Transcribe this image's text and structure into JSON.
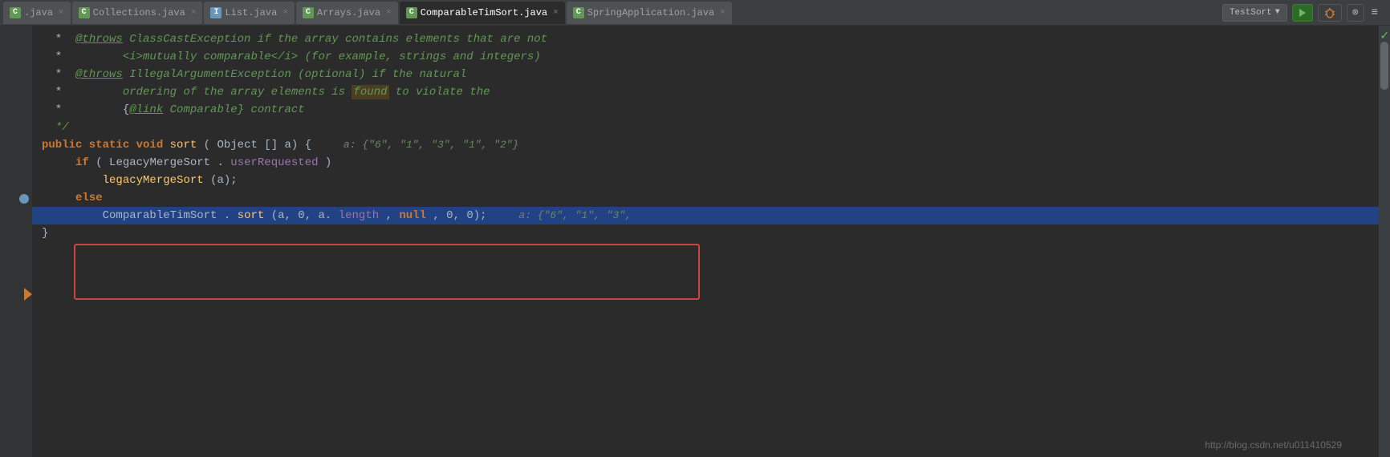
{
  "tabs": [
    {
      "id": "java1",
      "label": ".java",
      "icon": "C",
      "iconColor": "green",
      "active": false,
      "closable": true
    },
    {
      "id": "collections",
      "label": "Collections.java",
      "icon": "C",
      "iconColor": "green",
      "active": false,
      "closable": true
    },
    {
      "id": "list",
      "label": "List.java",
      "icon": "I",
      "iconColor": "blue-i",
      "active": false,
      "closable": true
    },
    {
      "id": "arrays",
      "label": "Arrays.java",
      "icon": "C",
      "iconColor": "green",
      "active": false,
      "closable": true
    },
    {
      "id": "comparabletimsort",
      "label": "ComparableTimSort.java",
      "icon": "C",
      "iconColor": "green",
      "active": true,
      "closable": true
    },
    {
      "id": "springapplication",
      "label": "SpringApplication.java",
      "icon": "C",
      "iconColor": "green",
      "active": false,
      "closable": true
    }
  ],
  "toolbar": {
    "run_config": "TestSort",
    "run_label": "Run",
    "overflow_label": "≡"
  },
  "code": {
    "lines": [
      {
        "indent": 0,
        "content": " *  <span class='cm-tag'>@throws</span><span class='cm'> ClassCastException if the array contains elements that are not</span>"
      },
      {
        "indent": 0,
        "content": " * <span class='cm'>         &lt;i&gt;mutually comparable&lt;/i&gt; (for example, strings and integers)</span>"
      },
      {
        "indent": 0,
        "content": " *  <span class='cm-tag'>@throws</span><span class='cm'> IllegalArgumentException (optional) if the natural</span>"
      },
      {
        "indent": 0,
        "content": " * <span class='cm'>         ordering of the array elements is </span><span class='cm' style='background:#4a3f20; padding:1px 2px;'>found</span><span class='cm'> to violate the</span>"
      },
      {
        "indent": 0,
        "content": " * <span class='cm'>         {<span class='link-tag'>@link</span> Comparable} contract</span>"
      },
      {
        "indent": 0,
        "content": " <span class='cm'>*/</span>"
      },
      {
        "indent": 0,
        "content": "<span class='kw'>public static void</span> <span class='method'>sort</span>(<span class='type'>Object</span>[] a) {  <span class='inline-hint'>a: {\"6\", \"1\", \"3\", \"1\", \"2\"}</span>"
      },
      {
        "indent": 1,
        "content": "<span class='kw'>if</span> (<span class='type'>LegacyMergeSort</span>.<span class='field'>userRequested</span>)"
      },
      {
        "indent": 2,
        "content": "<span class='method'>legacyMergeSort</span>(a);"
      },
      {
        "indent": 1,
        "content": "<span class='kw'>else</span>",
        "selected": true
      },
      {
        "indent": 2,
        "content": "<span class='type'>ComparableTimSort</span>.<span class='method'>sort</span>(a, 0, a.<span class='field'>length</span>, <span class='kw'>null</span>, 0, 0);  <span class='inline-hint'>a: {\"6\", \"1\", \"3\",</span>",
        "selected": true,
        "highlighted": true
      }
    ],
    "closing_brace": "}"
  },
  "watermark": "http://blog.csdn.net/u011410529"
}
